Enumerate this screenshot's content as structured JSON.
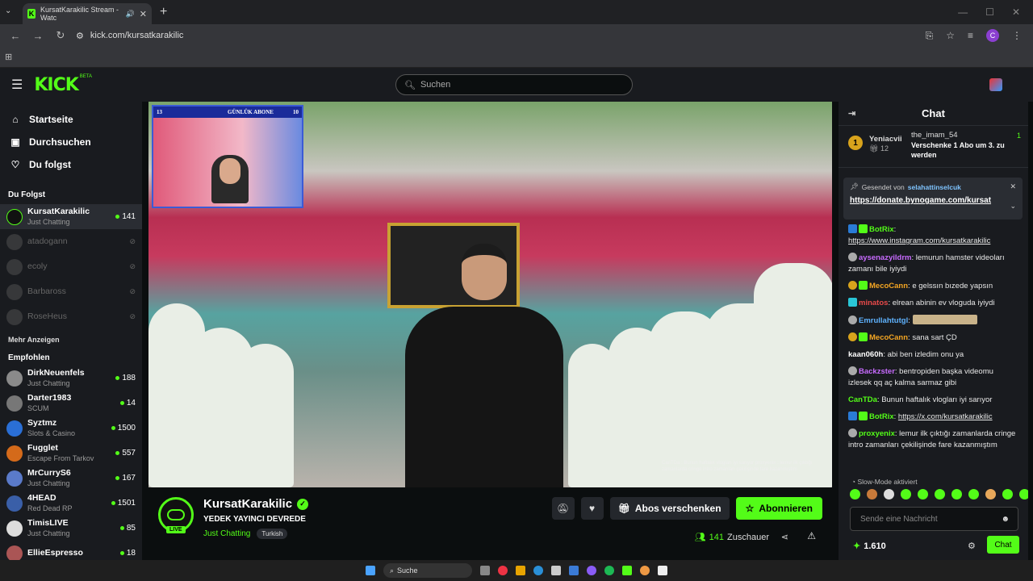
{
  "browser": {
    "tab_title": "KursatKarakilic Stream - Watc",
    "url": "kick.com/kursatkarakilic"
  },
  "header": {
    "logo": "KICK",
    "beta": "BETA",
    "search_placeholder": "Suchen"
  },
  "sidebar": {
    "nav": [
      {
        "label": "Startseite",
        "icon": "home-icon"
      },
      {
        "label": "Durchsuchen",
        "icon": "browse-icon"
      },
      {
        "label": "Du folgst",
        "icon": "heart-icon"
      }
    ],
    "following_title": "Du Folgst",
    "following": [
      {
        "name": "KursatKarakilic",
        "category": "Just Chatting",
        "viewers": "141",
        "live": true
      },
      {
        "name": "atadogann",
        "live": false
      },
      {
        "name": "ecoly",
        "live": false
      },
      {
        "name": "Barbaross",
        "live": false
      },
      {
        "name": "RoseHeus",
        "live": false
      }
    ],
    "more_label": "Mehr Anzeigen",
    "recommended_title": "Empfohlen",
    "recommended": [
      {
        "name": "DirkNeuenfels",
        "category": "Just Chatting",
        "viewers": "188"
      },
      {
        "name": "Darter1983",
        "category": "SCUM",
        "viewers": "14"
      },
      {
        "name": "Syztmz",
        "category": "Slots & Casino",
        "viewers": "1500"
      },
      {
        "name": "Fugglet",
        "category": "Escape From Tarkov",
        "viewers": "557"
      },
      {
        "name": "MrCurryS6",
        "category": "Just Chatting",
        "viewers": "167"
      },
      {
        "name": "4HEAD",
        "category": "Red Dead RP",
        "viewers": "1501"
      },
      {
        "name": "TimisLIVE",
        "category": "Just Chatting",
        "viewers": "85"
      },
      {
        "name": "EllieEspresso",
        "category": "",
        "viewers": "18"
      }
    ]
  },
  "video": {
    "overlay_title": "GÜNLÜK ABONE",
    "overlay_left": "13",
    "overlay_right": "10",
    "overlay_chat": "CanTDa : Bunun haftalık vlogları iyi sarıyor\nproxyenix : lemur ilk çıktığı zamanlarda cringe intro zamanları çekilişinde fare kazanmıştım"
  },
  "channel": {
    "name": "KursatKarakilic",
    "live_label": "LIVE",
    "title": "YEDEK YAYINCI DEVREDE",
    "category": "Just Chatting",
    "tag": "Turkish",
    "gift_label": "Abos verschenken",
    "subscribe_label": "Abonnieren",
    "viewers": "141",
    "viewers_label": "Zuschauer"
  },
  "chat": {
    "title": "Chat",
    "leader1": {
      "rank": "1",
      "name": "Yeniacvii",
      "count": "12"
    },
    "leader2": {
      "name": "the_imam_54",
      "count": "1",
      "text": "Verschenke 1 Abo um 3. zu werden"
    },
    "pinned_by": "Gesendet von",
    "pinned_user": "selahattinselcuk",
    "pinned_link": "https://donate.bynogame.com/kursat",
    "messages": [
      {
        "user": "BotRix",
        "color": "#53fc18",
        "text": "https://www.instagram.com/kursatkarakilic",
        "link": true
      },
      {
        "user": "aysenazyildrm",
        "color": "#c86bff",
        "text": "lemurun hamster videoları zamanı bile iyiydi"
      },
      {
        "user": "MecoCann",
        "color": "#f5a623",
        "text": "e gelssın bızede yapsın"
      },
      {
        "user": "minatos",
        "color": "#e84a4a",
        "text": "elrean abinin ev vloguda iyiydi"
      },
      {
        "user": "Emrullahtutgl",
        "color": "#5fb3ff",
        "text": ""
      },
      {
        "user": "MecoCann",
        "color": "#f5a623",
        "text": "sana sart ÇD"
      },
      {
        "user": "kaan060h",
        "color": "#ffffff",
        "text": "abi ben izledim onu ya"
      },
      {
        "user": "Backzster",
        "color": "#c86bff",
        "text": "bentropiden başka videomu izlesek qq aç kalma sarmaz gibi"
      },
      {
        "user": "CanTDa",
        "color": "#53fc18",
        "text": "Bunun haftalık vlogları iyi sarıyor"
      },
      {
        "user": "BotRix",
        "color": "#53fc18",
        "text": "https://x.com/kursatkarakilic",
        "link": true
      },
      {
        "user": "proxyenix",
        "color": "#53fc18",
        "text": "lemur ilk çıktığı zamanlarda cringe intro zamanları çekilişinde fare kazanmıştım"
      }
    ],
    "slow_mode": "Slow-Mode aktiviert",
    "input_placeholder": "Sende eine Nachricht",
    "points": "1.610",
    "send_label": "Chat"
  },
  "taskbar": {
    "search": "Suche"
  }
}
